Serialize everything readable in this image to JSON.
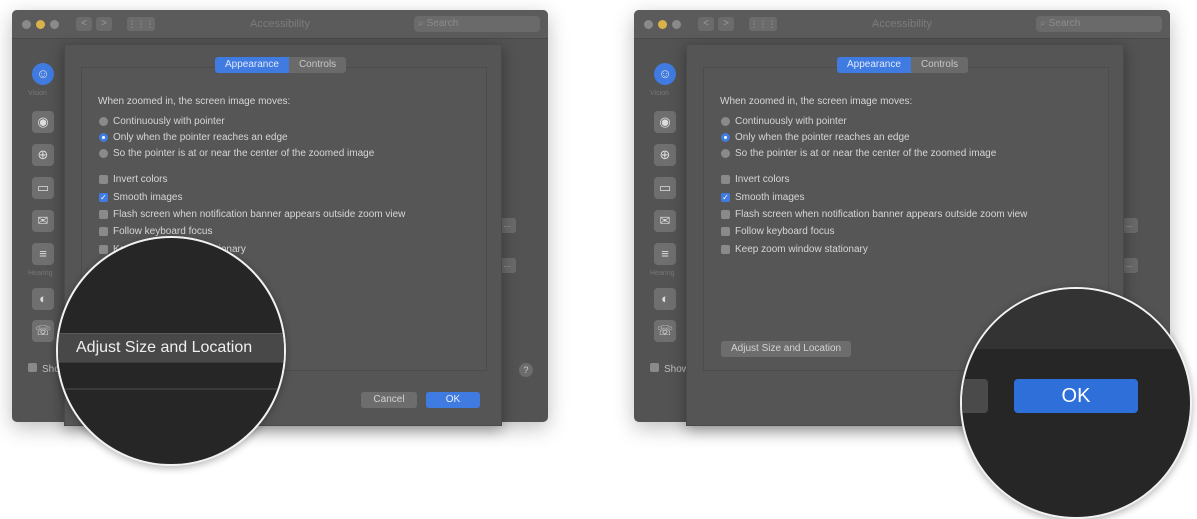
{
  "window": {
    "title": "Accessibility",
    "search_placeholder": "Search",
    "nav_back": "<",
    "nav_forward": ">",
    "grid_icon": "grid-icon"
  },
  "sidebar": {
    "section_vision": "Vision",
    "section_hearing": "Hearing",
    "icons": [
      "accessibility-icon",
      "voiceover-icon",
      "zoom-icon",
      "display-icon",
      "speech-icon",
      "descriptions-icon",
      "audio-icon",
      "rtt-icon"
    ],
    "show_label": "Show"
  },
  "tabs": {
    "appearance": "Appearance",
    "controls": "Controls"
  },
  "zoom_options": {
    "heading": "When zoomed in, the screen image moves:",
    "radios": [
      {
        "label": "Continuously with pointer",
        "selected": false
      },
      {
        "label": "Only when the pointer reaches an edge",
        "selected": true
      },
      {
        "label": "So the pointer is at or near the center of the zoomed image",
        "selected": false
      }
    ],
    "checkboxes": [
      {
        "label": "Invert colors",
        "checked": false
      },
      {
        "label": "Smooth images",
        "checked": true
      },
      {
        "label": "Flash screen when notification banner appears outside zoom view",
        "checked": false
      },
      {
        "label": "Follow keyboard focus",
        "checked": false
      },
      {
        "label": "Keep zoom window stationary",
        "checked": false
      }
    ]
  },
  "buttons": {
    "adjust": "Adjust Size and Location",
    "cancel": "Cancel",
    "ok": "OK",
    "ellipsis": "...",
    "help": "?"
  },
  "colors": {
    "accent": "#3f7be0",
    "window_bg": "#535353"
  }
}
